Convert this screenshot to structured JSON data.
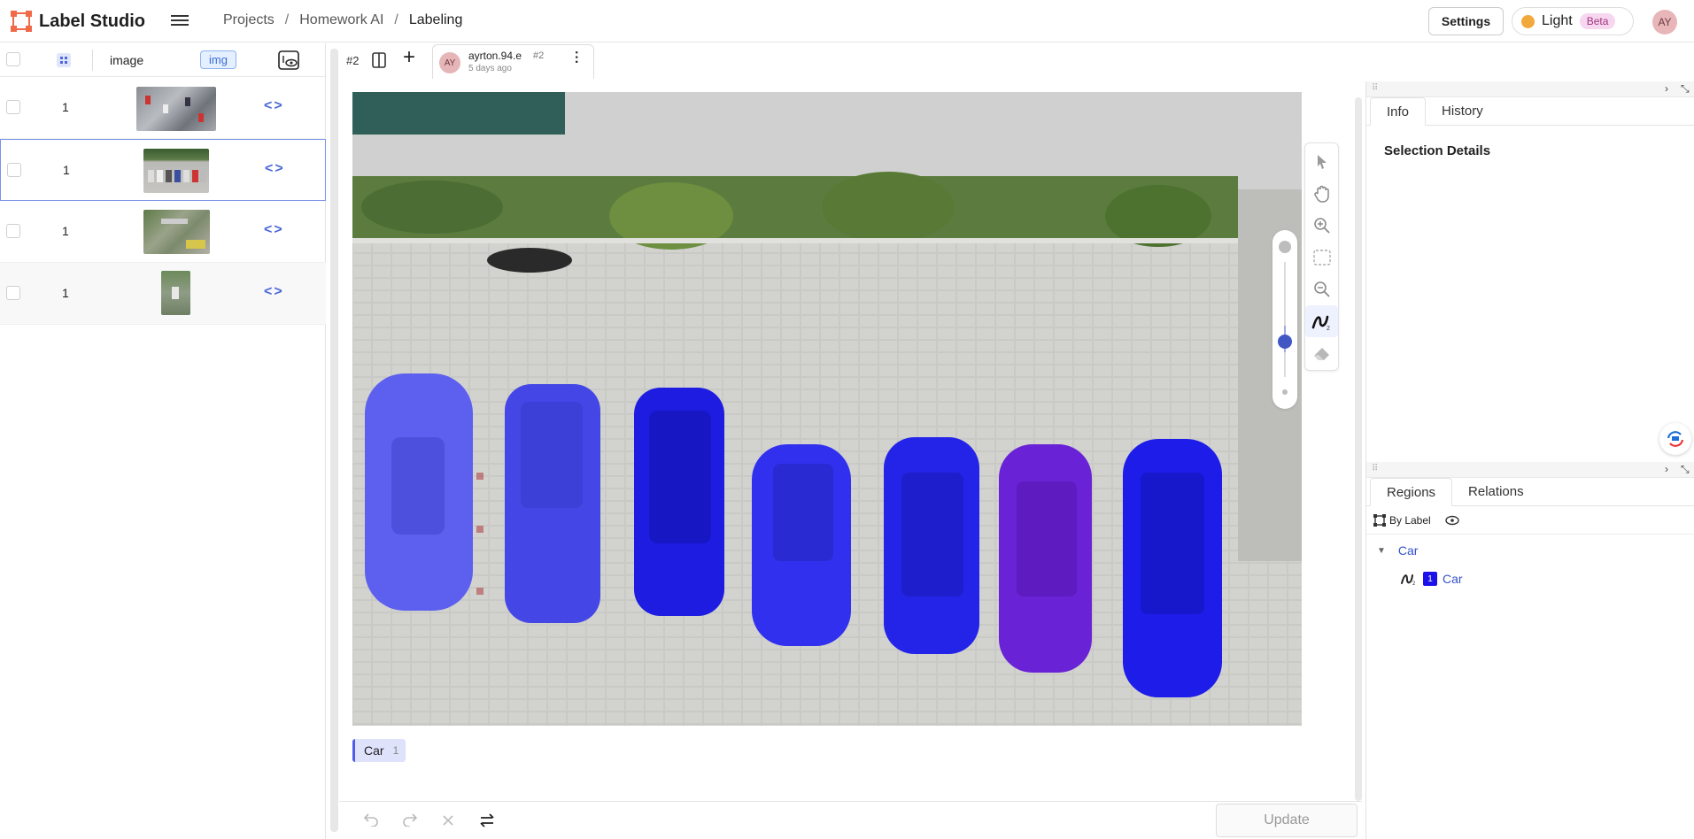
{
  "app": {
    "name": "Label Studio"
  },
  "breadcrumb": [
    "Projects",
    "Homework AI",
    "Labeling"
  ],
  "header": {
    "settings": "Settings",
    "theme": "Light",
    "theme_badge": "Beta",
    "avatar": "AY"
  },
  "list": {
    "columns": {
      "image": "image",
      "img_tag": "img"
    },
    "rows": [
      {
        "count": "1"
      },
      {
        "count": "1"
      },
      {
        "count": "1"
      },
      {
        "count": "1"
      }
    ]
  },
  "task": {
    "id": "#2"
  },
  "annotation": {
    "user": "ayrton.94.e",
    "id": "#2",
    "time": "5 days ago",
    "avatar": "AY"
  },
  "labels": [
    {
      "name": "Car",
      "hotkey": "1",
      "color": "#4f5ee8"
    }
  ],
  "bottom": {
    "update": "Update"
  },
  "info_panel": {
    "tabs": [
      "Info",
      "History"
    ],
    "title": "Selection Details"
  },
  "regions_panel": {
    "tabs": [
      "Regions",
      "Relations"
    ],
    "group_by": "By Label",
    "group": "Car",
    "items": [
      {
        "index": "1",
        "label": "Car"
      }
    ]
  },
  "colors": {
    "accent": "#4b68d6",
    "region": "#1a12e8",
    "brand": "#f06a4a"
  }
}
